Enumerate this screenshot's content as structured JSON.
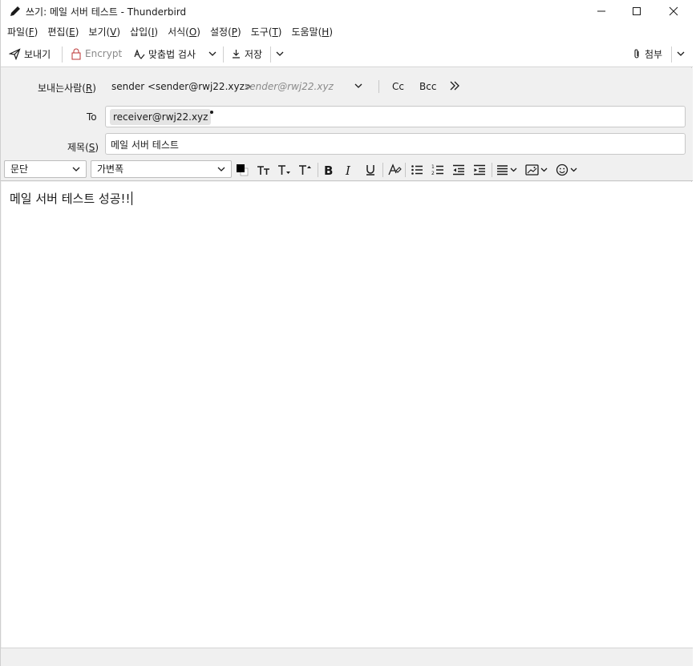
{
  "window": {
    "title": "쓰기: 메일 서버 테스트 - Thunderbird"
  },
  "menu": [
    {
      "label": "파일(",
      "key": "F",
      "end": ")"
    },
    {
      "label": "편집(",
      "key": "E",
      "end": ")"
    },
    {
      "label": "보기(",
      "key": "V",
      "end": ")"
    },
    {
      "label": "삽입(",
      "key": "I",
      "end": ")"
    },
    {
      "label": "서식(",
      "key": "O",
      "end": ")"
    },
    {
      "label": "설정(",
      "key": "P",
      "end": ")"
    },
    {
      "label": "도구(",
      "key": "T",
      "end": ")"
    },
    {
      "label": "도움말(",
      "key": "H",
      "end": ")"
    }
  ],
  "toolbar": {
    "send": "보내기",
    "encrypt": "Encrypt",
    "spellcheck": "맞춤법 검사",
    "save": "저장",
    "attach": "첨부"
  },
  "headers": {
    "from_label": "보내는사람(",
    "from_key": "R",
    "from_end": ")",
    "from_value": "sender <sender@rwj22.xyz>",
    "from_ghost": "sender@rwj22.xyz",
    "cc": "Cc",
    "bcc": "Bcc",
    "to_label": "To",
    "to_recipient": "receiver@rwj22.xyz",
    "subject_label": "제목(",
    "subject_key": "S",
    "subject_end": ")",
    "subject_value": "메일 서버 테스트"
  },
  "format": {
    "paragraph": "문단",
    "font": "가변폭"
  },
  "body": {
    "text": "메일 서버 테스트 성공!!"
  }
}
